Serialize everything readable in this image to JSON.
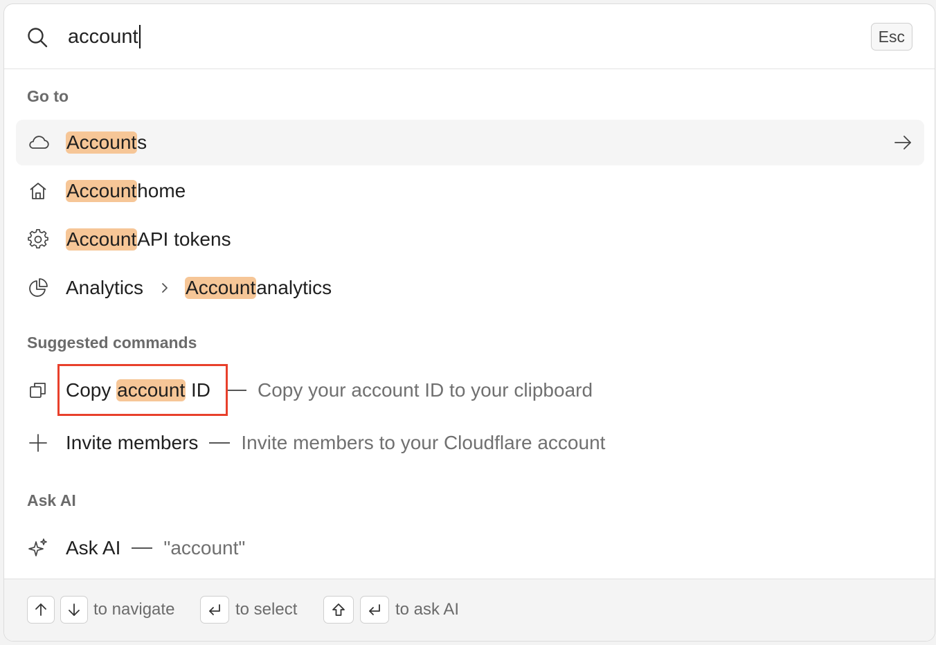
{
  "search": {
    "value": "account",
    "esc_label": "Esc"
  },
  "goto": {
    "section_label": "Go to",
    "items": [
      {
        "icon": "cloud-icon",
        "highlight": "Account",
        "rest": "s",
        "trailing_icon": "arrow-right-icon"
      },
      {
        "icon": "home-icon",
        "highlight": "Account",
        "rest": " home"
      },
      {
        "icon": "gear-icon",
        "highlight": "Account",
        "rest": " API tokens"
      },
      {
        "icon": "pie-chart-icon",
        "parent": "Analytics",
        "highlight": "Account",
        "rest": " analytics"
      }
    ]
  },
  "commands": {
    "section_label": "Suggested commands",
    "items": [
      {
        "icon": "copy-icon",
        "prefix": "Copy ",
        "highlight": "account",
        "rest": " ID",
        "description": "Copy your account ID to your clipboard"
      },
      {
        "icon": "plus-icon",
        "label": "Invite members",
        "description": "Invite members to your Cloudflare account"
      }
    ]
  },
  "ask_ai": {
    "section_label": "Ask AI",
    "label": "Ask AI",
    "query": "\"account\""
  },
  "footer": {
    "navigate_hint": "to navigate",
    "select_hint": "to select",
    "ask_ai_hint": "to ask AI"
  },
  "colors": {
    "match_highlight": "#f6c697",
    "annotation_box": "#e8402b"
  }
}
